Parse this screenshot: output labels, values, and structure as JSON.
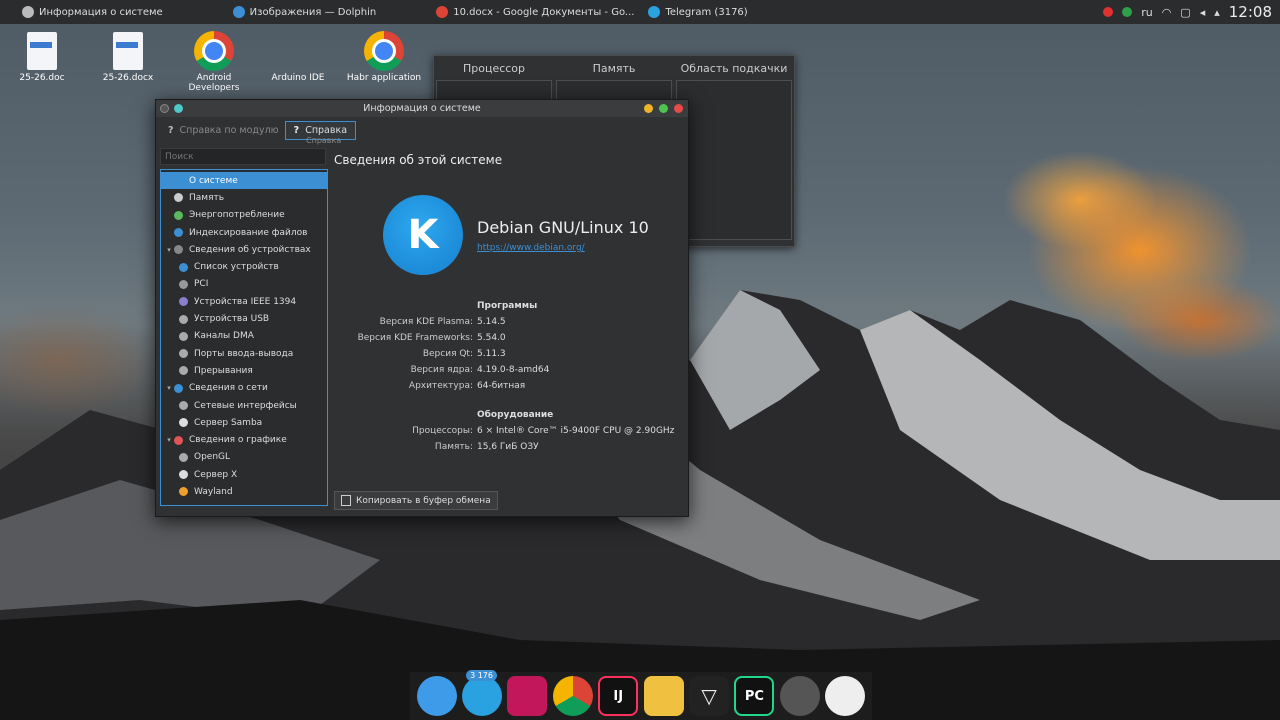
{
  "top_panel": {
    "tasks": [
      {
        "label": "Информация о системе",
        "color": "#bbbbbb"
      },
      {
        "label": "Изображения — Dolphin",
        "color": "#3d8fd4"
      },
      {
        "label": "10.docx - Google Документы - Go...",
        "color": "#db4437"
      },
      {
        "label": "Telegram (3176)",
        "color": "#2aa1e0"
      }
    ],
    "keyboard_layout": "ru",
    "clock": "12:08"
  },
  "desktop": {
    "icons": [
      {
        "label": "25-26.doc",
        "kind": "doc"
      },
      {
        "label": "25-26.docx",
        "kind": "doc"
      },
      {
        "label": "Android Developers",
        "kind": "chrome"
      },
      {
        "label": "Arduino IDE",
        "kind": "none"
      },
      {
        "label": "Habr application",
        "kind": "chrome"
      }
    ]
  },
  "system_monitor": {
    "tabs": [
      "Процессор",
      "Память",
      "Область подкачки"
    ]
  },
  "window": {
    "title": "Информация о системе",
    "toolbar": {
      "module_help": "Справка по модулю",
      "help": "Справка",
      "tooltip": "Справка"
    },
    "search_placeholder": "Поиск",
    "tree": [
      {
        "label": "О системе",
        "level": 0,
        "selected": true,
        "icon_color": "#3d8fd4"
      },
      {
        "label": "Память",
        "level": 0,
        "icon_color": "#cccccc"
      },
      {
        "label": "Энергопотребление",
        "level": 0,
        "icon_color": "#5cb85c"
      },
      {
        "label": "Индексирование файлов",
        "level": 0,
        "icon_color": "#3d8fd4"
      },
      {
        "label": "Сведения об устройствах",
        "level": 0,
        "expander": true,
        "icon_color": "#888888"
      },
      {
        "label": "Список устройств",
        "level": 1,
        "icon_color": "#3d8fd4"
      },
      {
        "label": "PCI",
        "level": 1,
        "icon_color": "#999999"
      },
      {
        "label": "Устройства IEEE 1394",
        "level": 1,
        "icon_color": "#8a7fd0"
      },
      {
        "label": "Устройства USB",
        "level": 1,
        "icon_color": "#aaaaaa"
      },
      {
        "label": "Каналы DMA",
        "level": 1,
        "icon_color": "#aaaaaa"
      },
      {
        "label": "Порты ввода-вывода",
        "level": 1,
        "icon_color": "#aaaaaa"
      },
      {
        "label": "Прерывания",
        "level": 1,
        "icon_color": "#aaaaaa"
      },
      {
        "label": "Сведения о сети",
        "level": 0,
        "expander": true,
        "icon_color": "#3d8fd4"
      },
      {
        "label": "Сетевые интерфейсы",
        "level": 1,
        "icon_color": "#aaaaaa"
      },
      {
        "label": "Сервер Samba",
        "level": 1,
        "icon_color": "#dddddd"
      },
      {
        "label": "Сведения о графике",
        "level": 0,
        "expander": true,
        "icon_color": "#e05555"
      },
      {
        "label": "OpenGL",
        "level": 1,
        "icon_color": "#aaaaaa"
      },
      {
        "label": "Сервер X",
        "level": 1,
        "icon_color": "#dddddd"
      },
      {
        "label": "Wayland",
        "level": 1,
        "icon_color": "#f0a030"
      }
    ],
    "content": {
      "heading": "Сведения об этой системе",
      "logo_letter": "K",
      "distro_name": "Debian GNU/Linux 10",
      "distro_url": "https://www.debian.org/",
      "software_title": "Программы",
      "software": [
        {
          "key": "Версия KDE Plasma:",
          "value": "5.14.5"
        },
        {
          "key": "Версия KDE Frameworks:",
          "value": "5.54.0"
        },
        {
          "key": "Версия Qt:",
          "value": "5.11.3"
        },
        {
          "key": "Версия ядра:",
          "value": "4.19.0-8-amd64"
        },
        {
          "key": "Архитектура:",
          "value": "64-битная"
        }
      ],
      "hardware_title": "Оборудование",
      "hardware": [
        {
          "key": "Процессоры:",
          "value": "6 × Intel® Core™ i5-9400F CPU @ 2.90GHz"
        },
        {
          "key": "Память:",
          "value": "15,6 ГиБ ОЗУ"
        }
      ],
      "copy_button": "Копировать в буфер обмена"
    }
  },
  "dock": {
    "items": [
      {
        "name": "finder",
        "label": "",
        "color": "#3d9be9"
      },
      {
        "name": "telegram",
        "label": "",
        "badge": "3 176",
        "color": "#2aa1e0"
      },
      {
        "name": "cube-app",
        "label": "",
        "color": "#c2185b"
      },
      {
        "name": "chrome",
        "label": "",
        "color": "#db4437"
      },
      {
        "name": "intellij",
        "label": "IJ",
        "color": "#111111"
      },
      {
        "name": "android-studio",
        "label": "",
        "color": "#f0c040"
      },
      {
        "name": "vectorize",
        "label": "▽",
        "color": "#222222"
      },
      {
        "name": "pycharm",
        "label": "PC",
        "color": "#111111"
      },
      {
        "name": "settings",
        "label": "",
        "color": "#555555"
      },
      {
        "name": "clock",
        "label": "",
        "color": "#eeeeee"
      }
    ]
  }
}
